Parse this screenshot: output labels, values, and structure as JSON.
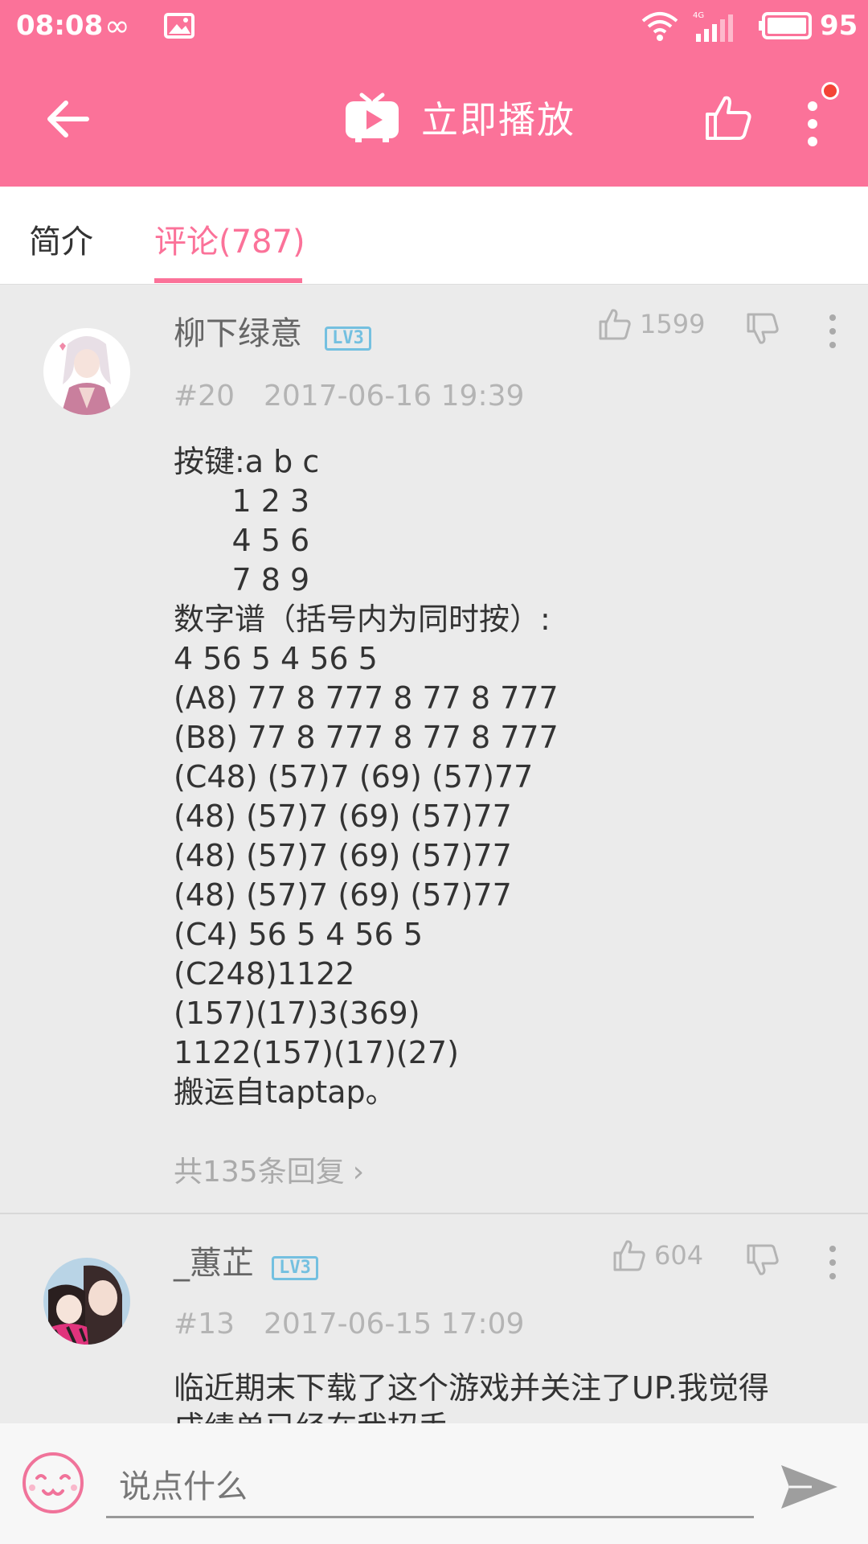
{
  "status_bar": {
    "time": "08:08",
    "network": "4G",
    "battery": "95"
  },
  "toolbar": {
    "play_title": "立即播放"
  },
  "tabs": [
    {
      "label": "简介",
      "active": false
    },
    {
      "label": "评论(787)",
      "active": true
    }
  ],
  "comments": [
    {
      "username": "柳下绿意",
      "level": "LV3",
      "floor": "#20",
      "timestamp": "2017-06-16 19:39",
      "likes": "1599",
      "lines": [
        "按键:a b c",
        "      1 2 3",
        "      4 5 6",
        "      7 8 9",
        "数字谱（括号内为同时按）:",
        "4 56 5 4 56 5",
        "(A8) 77 8 777 8 77 8 777",
        "(B8) 77 8 777 8 77 8 777",
        "(C48) (57)7 (69) (57)77",
        "(48) (57)7 (69) (57)77",
        "(48) (57)7 (69) (57)77",
        "(48) (57)7 (69) (57)77",
        "(C4) 56 5 4 56 5",
        "(C248)1122",
        "(157)(17)3(369)",
        "1122(157)(17)(27)",
        "搬运自taptap。"
      ],
      "replies": "共135条回复"
    },
    {
      "username": "_蕙芷",
      "level": "LV3",
      "floor": "#13",
      "timestamp": "2017-06-15 17:09",
      "likes": "604",
      "lines": [
        "临近期末下载了这个游戏并关注了UP.我觉得",
        "成绩单已经在我招手"
      ]
    }
  ],
  "input": {
    "placeholder": "说点什么"
  },
  "colors": {
    "accent": "#fb7299",
    "level_badge": "#74c0e0",
    "muted": "#b4b4b4",
    "badge_dot": "#f44336"
  }
}
